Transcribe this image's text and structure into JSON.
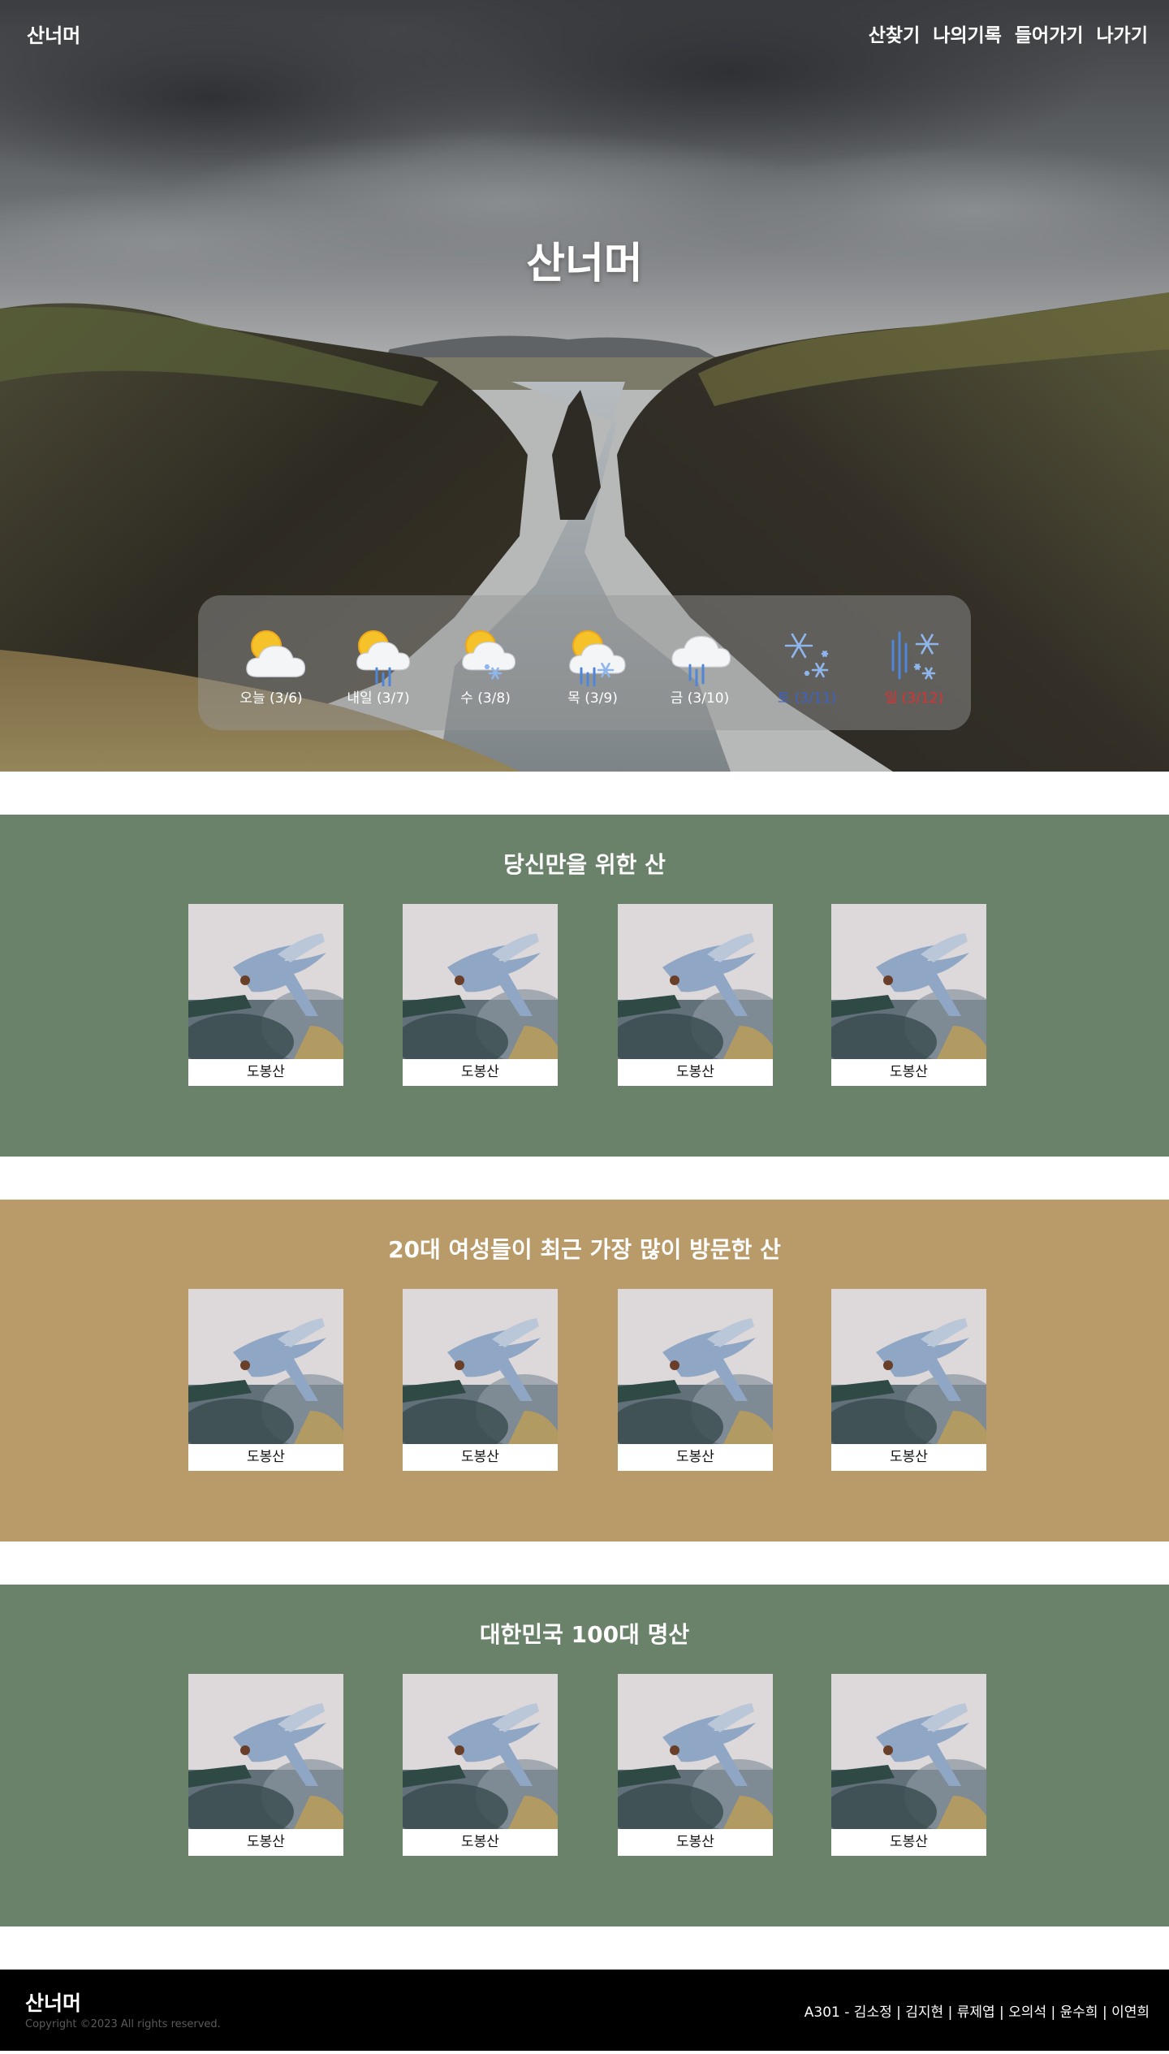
{
  "nav": {
    "brand": "산너머",
    "menu": [
      "산찾기",
      "나의기록",
      "들어가기",
      "나가기"
    ]
  },
  "hero": {
    "title": "산너머"
  },
  "weather": [
    {
      "label": "오늘 (3/6)",
      "icon": "sun-behind-cloud-icon",
      "tone": "default"
    },
    {
      "label": "내일 (3/7)",
      "icon": "sun-cloud-rain-icon",
      "tone": "default"
    },
    {
      "label": "수 (3/8)",
      "icon": "sun-cloud-snow-icon",
      "tone": "default"
    },
    {
      "label": "목 (3/9)",
      "icon": "sun-cloud-rain-snow-icon",
      "tone": "default"
    },
    {
      "label": "금 (3/10)",
      "icon": "cloud-rain-icon",
      "tone": "default"
    },
    {
      "label": "토 (3/11)",
      "icon": "snow-icon",
      "tone": "saturday"
    },
    {
      "label": "일 (3/12)",
      "icon": "rain-snow-icon",
      "tone": "sunday"
    }
  ],
  "sections": [
    {
      "title": "당신만을 위한 산",
      "color": "#6a816a",
      "cards": [
        "도봉산",
        "도봉산",
        "도봉산",
        "도봉산"
      ]
    },
    {
      "title": "20대 여성들이 최근 가장 많이 방문한 산",
      "color": "#b99a69",
      "cards": [
        "도봉산",
        "도봉산",
        "도봉산",
        "도봉산"
      ]
    },
    {
      "title": "대한민국 100대 명산",
      "color": "#6a816a",
      "cards": [
        "도봉산",
        "도봉산",
        "도봉산",
        "도봉산"
      ]
    }
  ],
  "footer": {
    "brand": "산너머",
    "copyright": "Copyright ©2023 All rights reserved.",
    "team": "A301 - 김소정 | 김지현 | 류제엽 | 오의석 | 윤수희 | 이연희"
  },
  "colors": {
    "green_section": "#6a816a",
    "tan_section": "#b99a69",
    "saturday": "#3a64c8",
    "sunday": "#e03030"
  }
}
